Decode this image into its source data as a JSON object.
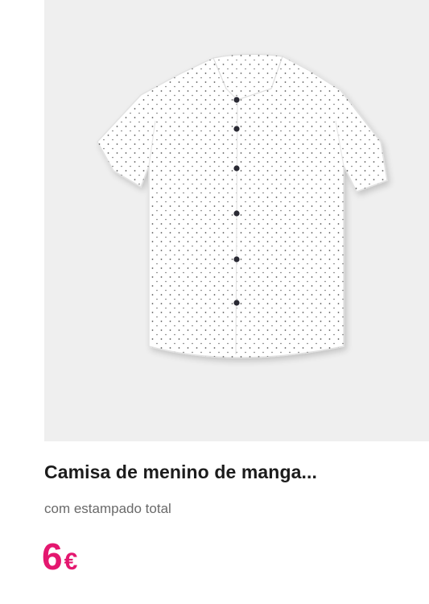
{
  "product": {
    "image_icon": "shirt-icon",
    "title": "Camisa de menino de manga...",
    "subtitle": "com estampado total",
    "price": {
      "amount": "6",
      "currency": "€"
    },
    "colors": {
      "price": "#e4176f",
      "image_background": "#efefef"
    }
  }
}
